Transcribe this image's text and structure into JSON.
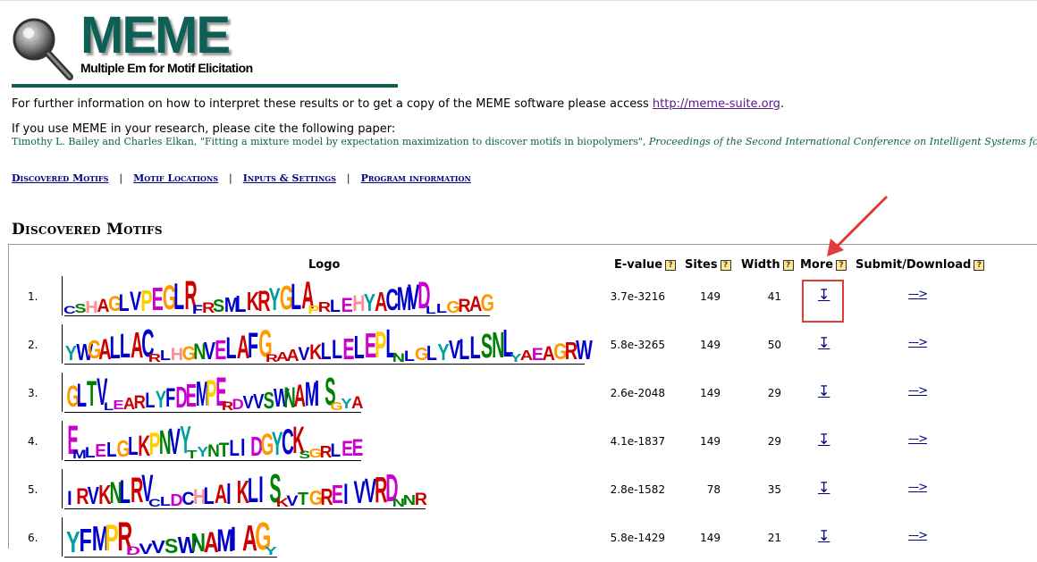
{
  "header": {
    "title": "MEME",
    "subtitle": "Multiple Em for Motif Elicitation",
    "brand_color": "#0e5f55"
  },
  "info": {
    "text": "For further information on how to interpret these results or to get a copy of the MEME software please access ",
    "link": "http://meme-suite.org",
    "tail": "."
  },
  "citation": {
    "intro": "If you use MEME in your research, please cite the following paper:",
    "authors": "Timothy L. Bailey and Charles Elkan, \"Fitting a mixture model by expectation maximization to discover motifs in biopolymers\", ",
    "venue": "Proceedings of the Second International Conference on Intelligent Systems for Molecular Biology"
  },
  "nav": {
    "items": [
      "Discovered Motifs",
      "Motif Locations",
      "Inputs & Settings",
      "Program information"
    ],
    "separator": "|"
  },
  "section_title": "Discovered Motifs",
  "table": {
    "headers": {
      "logo": "Logo",
      "evalue": "E-value",
      "sites": "Sites",
      "width": "Width",
      "more": "More",
      "submit": "Submit/Download"
    },
    "help_glyph": "?",
    "download_glyph": "↧",
    "submit_glyph": "--->",
    "rows": [
      {
        "num": "1.",
        "evalue": "3.7e-3216",
        "sites": "149",
        "width": "41",
        "logo": "CSHAGLVPEGLRFRSMLKRYGLAPRLEHYACMVDLLGRAG"
      },
      {
        "num": "2.",
        "evalue": "5.8e-3265",
        "sites": "149",
        "width": "50",
        "logo": "YWGALLACRLHGNVELAFGRAAVKLLELEPLNLGLYVLLSNLYAEAGRW"
      },
      {
        "num": "3.",
        "evalue": "2.6e-2048",
        "sites": "149",
        "width": "29",
        "logo": "GLTVLEARLYFDEMPERDVVSWNAMISGYA"
      },
      {
        "num": "4.",
        "evalue": "4.1e-1837",
        "sites": "149",
        "width": "29",
        "logo": "EMLELGLKPNVYTYNTLIDGYCKSGRLEE"
      },
      {
        "num": "5.",
        "evalue": "2.8e-1582",
        "sites": "78",
        "width": "35",
        "logo": "IRVKNLRVCLDCHLAIKLISKVTGREIVVRDNNR"
      },
      {
        "num": "6.",
        "evalue": "5.8e-1429",
        "sites": "149",
        "width": "21",
        "logo": "YFMPRDVVSWNAMIAGY"
      }
    ]
  }
}
